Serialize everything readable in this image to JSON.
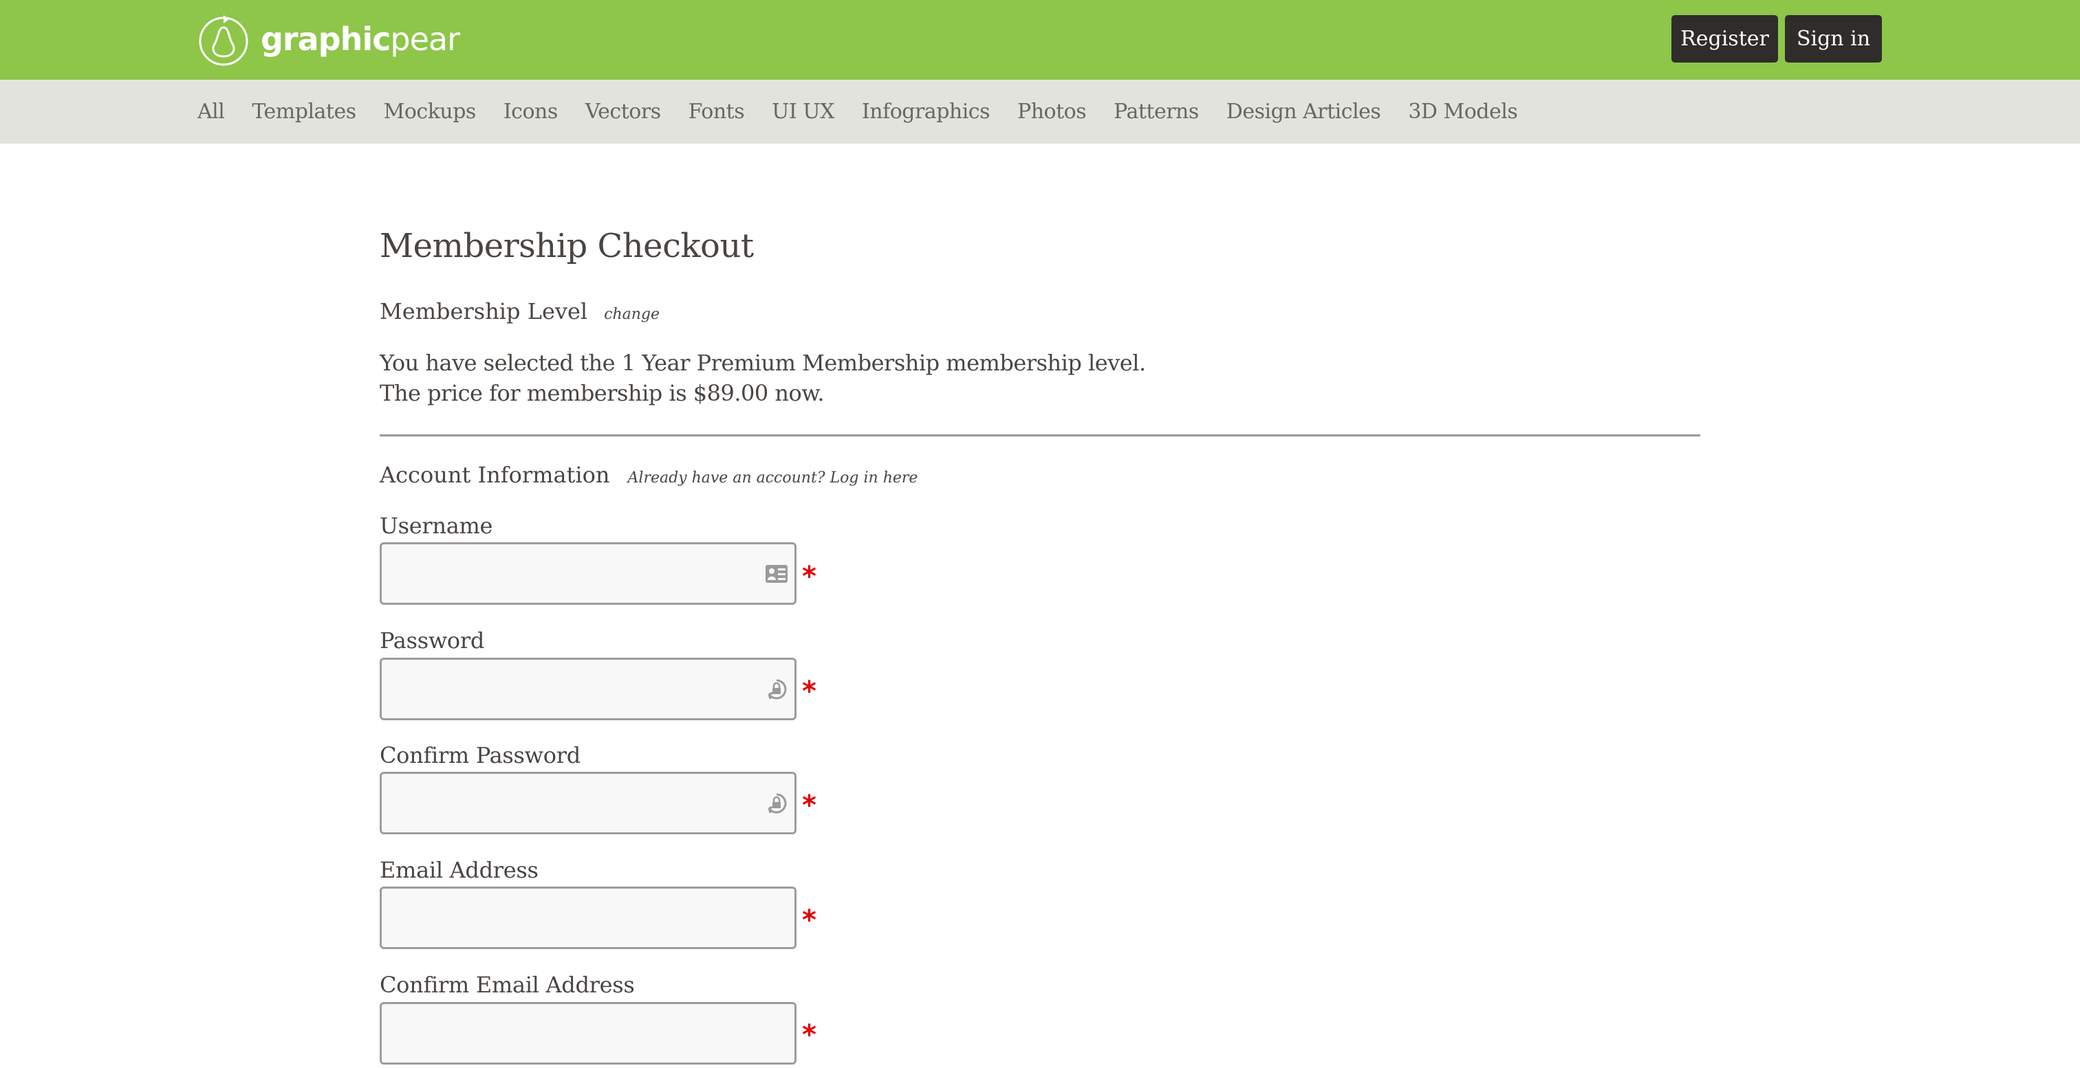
{
  "header": {
    "logo": {
      "bold": "graphic",
      "light": "pear",
      "icon": "pear-logo-icon"
    },
    "buttons": {
      "register": "Register",
      "signin": "Sign in"
    },
    "colors": {
      "brand_green": "#8dc649",
      "button_dark": "#302c2b",
      "nav_bg": "#e3e3de",
      "required": "#e10000"
    }
  },
  "nav": {
    "items": [
      "All",
      "Templates",
      "Mockups",
      "Icons",
      "Vectors",
      "Fonts",
      "UI UX",
      "Infographics",
      "Photos",
      "Patterns",
      "Design Articles",
      "3D Models"
    ]
  },
  "checkout": {
    "title": "Membership Checkout",
    "level": {
      "heading": "Membership Level",
      "change_link": "change",
      "selected_text": "You have selected the 1 Year Premium Membership membership level.",
      "price_text": "The price for membership is $89.00 now."
    },
    "account": {
      "heading": "Account Information",
      "login_link": "Already have an account? Log in here",
      "required_mark": "*",
      "fields": [
        {
          "label": "Username",
          "value": "",
          "icon": "contact-card-icon"
        },
        {
          "label": "Password",
          "value": "",
          "icon": "password-lock-icon"
        },
        {
          "label": "Confirm Password",
          "value": "",
          "icon": "password-lock-icon"
        },
        {
          "label": "Email Address",
          "value": ""
        },
        {
          "label": "Confirm Email Address",
          "value": ""
        }
      ]
    }
  }
}
